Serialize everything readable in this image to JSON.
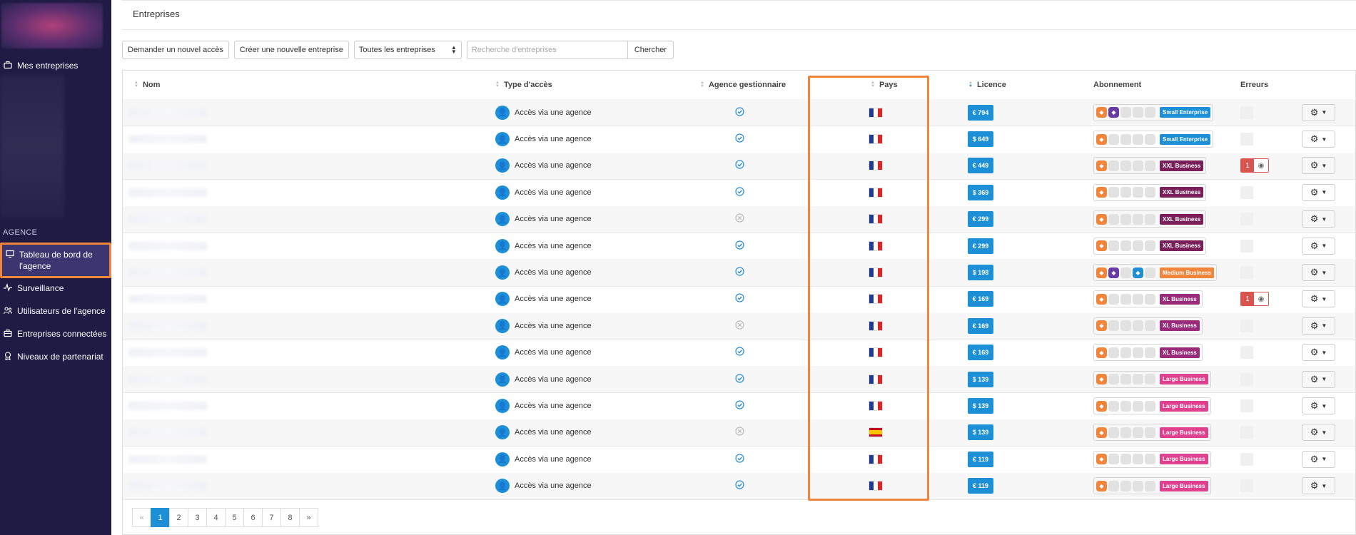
{
  "sidebar": {
    "top_items": [
      {
        "label": "Mes entreprises",
        "icon": "briefcase-icon"
      }
    ],
    "section_label": "AGENCE",
    "items": [
      {
        "label": "Tableau de bord de l'agence",
        "icon": "monitor-icon",
        "active": true
      },
      {
        "label": "Surveillance",
        "icon": "pulse-icon"
      },
      {
        "label": "Utilisateurs de l'agence",
        "icon": "users-icon"
      },
      {
        "label": "Entreprises connectées",
        "icon": "briefcase-icon"
      },
      {
        "label": "Niveaux de partenariat",
        "icon": "award-icon"
      }
    ]
  },
  "header": {
    "title": "Entreprises"
  },
  "toolbar": {
    "request_access": "Demander un nouvel accès",
    "create_company": "Créer une nouvelle entreprise",
    "filter_selected": "Toutes les entreprises",
    "search_placeholder": "Recherche d'entreprises",
    "search_button": "Chercher"
  },
  "table": {
    "columns": [
      "Nom",
      "Type d'accès",
      "Agence gestionnaire",
      "Pays",
      "Licence",
      "Abonnement",
      "Erreurs"
    ],
    "rows": [
      {
        "access": "Accès via une agence",
        "managed": true,
        "country": "FR",
        "licence": "€ 794",
        "plan": "Small Enterprise",
        "plan_color": "#1c8fd6",
        "modules": [
          1,
          1,
          0,
          0,
          0
        ],
        "errors": 0
      },
      {
        "access": "Accès via une agence",
        "managed": true,
        "country": "FR",
        "licence": "$ 649",
        "plan": "Small Enterprise",
        "plan_color": "#1c8fd6",
        "modules": [
          1,
          0,
          0,
          0,
          0
        ],
        "errors": 0
      },
      {
        "access": "Accès via une agence",
        "managed": true,
        "country": "FR",
        "licence": "€ 449",
        "plan": "XXL Business",
        "plan_color": "#7b1f5a",
        "modules": [
          1,
          0,
          0,
          0,
          0
        ],
        "errors": 1
      },
      {
        "access": "Accès via une agence",
        "managed": true,
        "country": "FR",
        "licence": "$ 369",
        "plan": "XXL Business",
        "plan_color": "#7b1f5a",
        "modules": [
          1,
          0,
          0,
          0,
          0
        ],
        "errors": 0
      },
      {
        "access": "Accès via une agence",
        "managed": false,
        "country": "FR",
        "licence": "€ 299",
        "plan": "XXL Business",
        "plan_color": "#7b1f5a",
        "modules": [
          1,
          0,
          0,
          0,
          0
        ],
        "errors": 0
      },
      {
        "access": "Accès via une agence",
        "managed": true,
        "country": "FR",
        "licence": "€ 299",
        "plan": "XXL Business",
        "plan_color": "#7b1f5a",
        "modules": [
          1,
          0,
          0,
          0,
          0
        ],
        "errors": 0
      },
      {
        "access": "Accès via une agence",
        "managed": true,
        "country": "FR",
        "licence": "$ 198",
        "plan": "Medium Business",
        "plan_color": "#f0853b",
        "modules": [
          1,
          1,
          0,
          1,
          0
        ],
        "errors": 0
      },
      {
        "access": "Accès via une agence",
        "managed": true,
        "country": "FR",
        "licence": "€ 169",
        "plan": "XL Business",
        "plan_color": "#9a2a7a",
        "modules": [
          1,
          0,
          0,
          0,
          0
        ],
        "errors": 1
      },
      {
        "access": "Accès via une agence",
        "managed": false,
        "country": "FR",
        "licence": "€ 169",
        "plan": "XL Business",
        "plan_color": "#9a2a7a",
        "modules": [
          1,
          0,
          0,
          0,
          0
        ],
        "errors": 0
      },
      {
        "access": "Accès via une agence",
        "managed": true,
        "country": "FR",
        "licence": "€ 169",
        "plan": "XL Business",
        "plan_color": "#9a2a7a",
        "modules": [
          1,
          0,
          0,
          0,
          0
        ],
        "errors": 0
      },
      {
        "access": "Accès via une agence",
        "managed": true,
        "country": "FR",
        "licence": "$ 139",
        "plan": "Large Business",
        "plan_color": "#e0418f",
        "modules": [
          1,
          0,
          0,
          0,
          0
        ],
        "errors": 0
      },
      {
        "access": "Accès via une agence",
        "managed": true,
        "country": "FR",
        "licence": "$ 139",
        "plan": "Large Business",
        "plan_color": "#e0418f",
        "modules": [
          1,
          0,
          0,
          0,
          0
        ],
        "errors": 0
      },
      {
        "access": "Accès via une agence",
        "managed": false,
        "country": "ES",
        "licence": "$ 139",
        "plan": "Large Business",
        "plan_color": "#e0418f",
        "modules": [
          1,
          0,
          0,
          0,
          0
        ],
        "errors": 0
      },
      {
        "access": "Accès via une agence",
        "managed": true,
        "country": "FR",
        "licence": "€ 119",
        "plan": "Large Business",
        "plan_color": "#e0418f",
        "modules": [
          1,
          0,
          0,
          0,
          0
        ],
        "errors": 0
      },
      {
        "access": "Accès via une agence",
        "managed": true,
        "country": "FR",
        "licence": "€ 119",
        "plan": "Large Business",
        "plan_color": "#e0418f",
        "modules": [
          1,
          0,
          0,
          0,
          0
        ],
        "errors": 0
      }
    ]
  },
  "pagination": {
    "prev": "«",
    "pages": [
      "1",
      "2",
      "3",
      "4",
      "5",
      "6",
      "7",
      "8"
    ],
    "active": "1",
    "next": "»"
  }
}
